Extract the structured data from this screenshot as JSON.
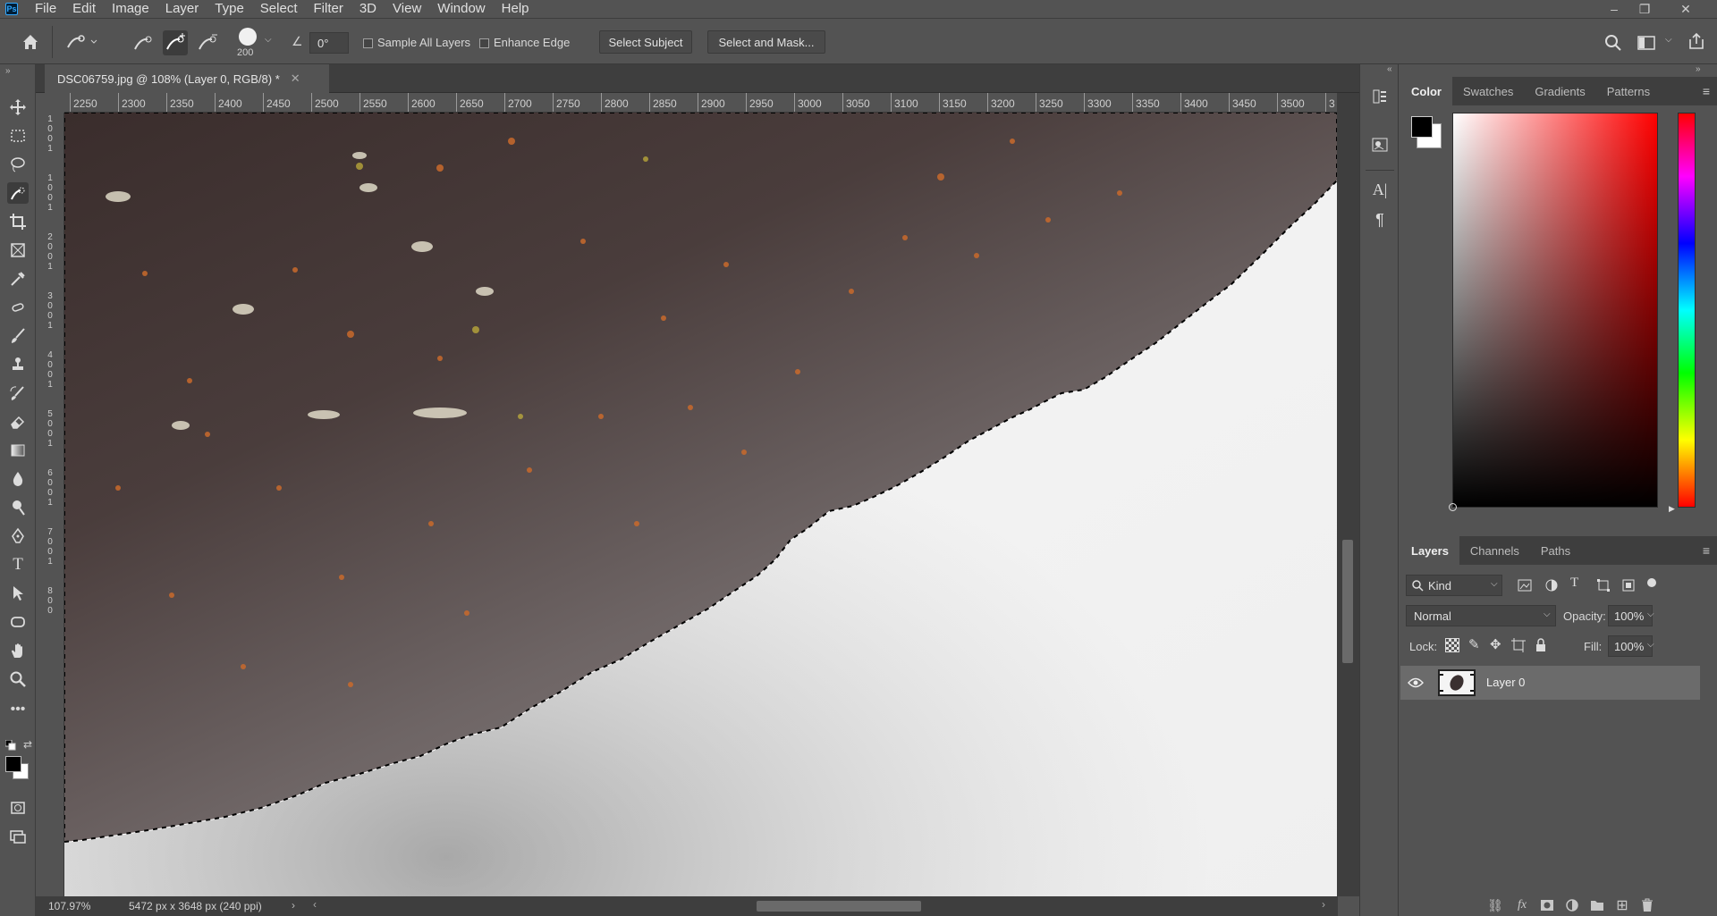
{
  "app": {
    "logo": "Ps"
  },
  "menu": [
    "File",
    "Edit",
    "Image",
    "Layer",
    "Type",
    "Select",
    "Filter",
    "3D",
    "View",
    "Window",
    "Help"
  ],
  "window_controls": {
    "minimize": "–",
    "restore": "❐",
    "close": "✕"
  },
  "options": {
    "brush_size": "200",
    "angle": "0°",
    "sample_all_layers": "Sample All Layers",
    "enhance_edge": "Enhance Edge",
    "select_subject": "Select Subject",
    "select_and_mask": "Select and Mask..."
  },
  "document": {
    "tab_title": "DSC06759.jpg @ 108% (Layer 0, RGB/8) *",
    "zoom": "107.97%",
    "dimensions": "5472 px x 3648 px (240 ppi)"
  },
  "ruler": {
    "h_ticks": [
      "2250",
      "2300",
      "2350",
      "2400",
      "2450",
      "2500",
      "2550",
      "2600",
      "2650",
      "2700",
      "2750",
      "2800",
      "2850",
      "2900",
      "2950",
      "3000",
      "3050",
      "3100",
      "3150",
      "3200",
      "3250",
      "3300",
      "3350",
      "3400",
      "3450",
      "3500",
      "3"
    ],
    "v_ticks": [
      "1",
      "0",
      "0",
      "1",
      "1",
      "0",
      "0",
      "1",
      "2",
      "0",
      "0",
      "1",
      "3",
      "0",
      "0",
      "1",
      "4",
      "0",
      "0",
      "1",
      "5",
      "0",
      "0",
      "1",
      "6",
      "0",
      "0",
      "1",
      "7",
      "0",
      "0",
      "1",
      "8",
      "0",
      "0"
    ]
  },
  "color_panel": {
    "tabs": [
      "Color",
      "Swatches",
      "Gradients",
      "Patterns"
    ],
    "active_tab": "Color",
    "foreground": "#000000",
    "background": "#ffffff"
  },
  "layers_panel": {
    "tabs": [
      "Layers",
      "Channels",
      "Paths"
    ],
    "active_tab": "Layers",
    "filter_kind": "Kind",
    "blend_mode": "Normal",
    "opacity_label": "Opacity:",
    "opacity": "100%",
    "lock_label": "Lock:",
    "fill_label": "Fill:",
    "fill": "100%",
    "layers": [
      {
        "name": "Layer 0",
        "visible": true
      }
    ]
  },
  "colors": {
    "accent": "#31a8ff",
    "panel": "#535353",
    "dark": "#3e3e3e"
  }
}
